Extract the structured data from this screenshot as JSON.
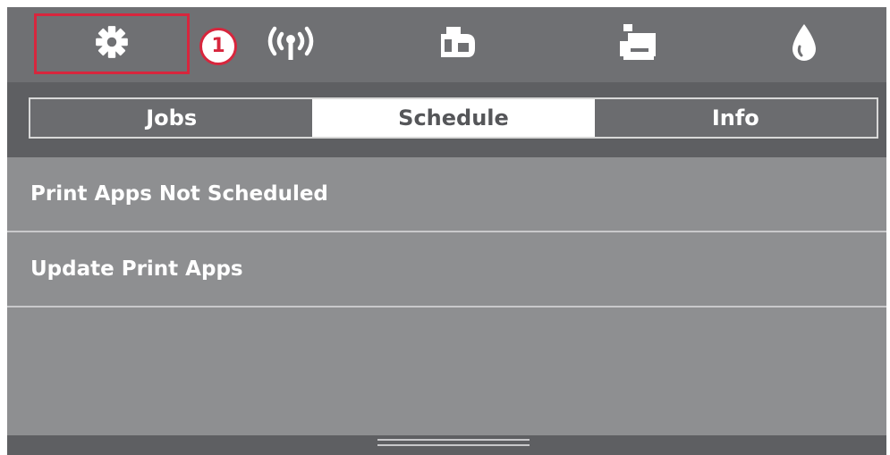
{
  "callout_number": "1",
  "icons": {
    "settings": "gear-icon",
    "wireless": "wireless-icon",
    "web_services": "web-services-icon",
    "printer": "printer-icon",
    "ink": "ink-drop-icon"
  },
  "tabs": [
    {
      "label": "Jobs",
      "active": false
    },
    {
      "label": "Schedule",
      "active": true
    },
    {
      "label": "Info",
      "active": false
    }
  ],
  "list_items": [
    {
      "label": "Print Apps Not Scheduled"
    },
    {
      "label": "Update Print Apps"
    }
  ],
  "colors": {
    "highlight": "#d7263d",
    "topbar": "#6f7073",
    "content": "#8e8f91"
  }
}
